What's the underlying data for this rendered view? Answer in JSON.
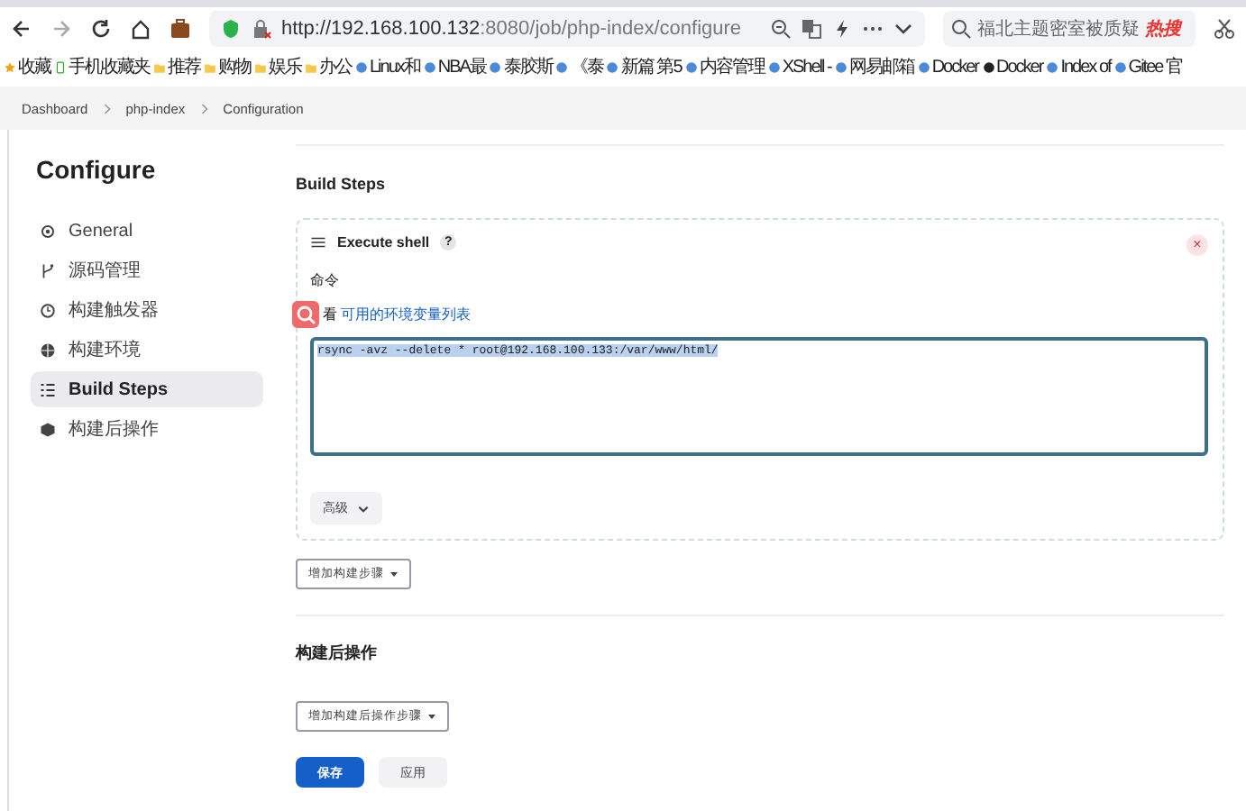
{
  "browser": {
    "url_host": "http://192.168.100.132",
    "url_rest": ":8080/job/php-index/configure",
    "search_placeholder": "福北主题密室被质疑",
    "search_hot": "热搜"
  },
  "bookmarks": [
    {
      "label": "收藏",
      "kind": "star"
    },
    {
      "label": "手机收藏夹",
      "kind": "phone"
    },
    {
      "label": "推荐",
      "kind": "folder"
    },
    {
      "label": "购物",
      "kind": "folder"
    },
    {
      "label": "娱乐",
      "kind": "folder"
    },
    {
      "label": "办公",
      "kind": "folder"
    },
    {
      "label": "Linux和",
      "kind": "site"
    },
    {
      "label": "NBA最",
      "kind": "site"
    },
    {
      "label": "泰胶斯",
      "kind": "site"
    },
    {
      "label": "《泰",
      "kind": "site"
    },
    {
      "label": "新篇 第5",
      "kind": "site"
    },
    {
      "label": "内容管理",
      "kind": "site"
    },
    {
      "label": "XShell -",
      "kind": "site"
    },
    {
      "label": "网易邮箱",
      "kind": "site"
    },
    {
      "label": "Docker",
      "kind": "site"
    },
    {
      "label": "Docker",
      "kind": "github"
    },
    {
      "label": "Index of",
      "kind": "site"
    },
    {
      "label": "Gitee 官",
      "kind": "site"
    }
  ],
  "breadcrumbs": [
    "Dashboard",
    "php-index",
    "Configuration"
  ],
  "sidebar": {
    "title": "Configure",
    "items": [
      {
        "label": "General",
        "selected": false
      },
      {
        "label": "源码管理",
        "selected": false
      },
      {
        "label": "构建触发器",
        "selected": false
      },
      {
        "label": "构建环境",
        "selected": false
      },
      {
        "label": "Build Steps",
        "selected": true
      },
      {
        "label": "构建后操作",
        "selected": false
      }
    ]
  },
  "build_steps": {
    "title": "Build Steps",
    "step": {
      "title": "Execute shell",
      "help": "?",
      "close": "×",
      "command_label": "命令",
      "env_prefix": "看",
      "env_link": "可用的环境变量列表",
      "command": "rsync -avz --delete * root@192.168.100.133:/var/www/html/",
      "advanced": "高级"
    },
    "add_button": "增加构建步骤"
  },
  "post_build": {
    "title": "构建后操作",
    "add_button": "增加构建后操作步骤"
  },
  "buttons": [
    {
      "label": "保存",
      "kind": "primary"
    },
    {
      "label": "应用",
      "kind": "secondary"
    }
  ]
}
